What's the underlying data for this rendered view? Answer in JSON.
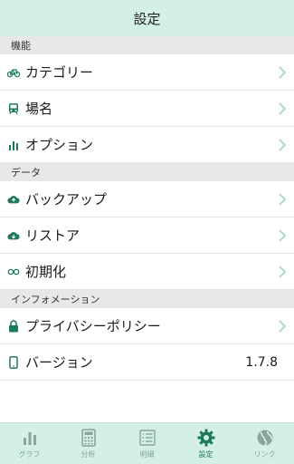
{
  "header": {
    "title": "設定"
  },
  "sections": {
    "function": "機能",
    "data": "データ",
    "info": "インフォメーション"
  },
  "rows": {
    "category": "カテゴリー",
    "place": "場名",
    "option": "オプション",
    "backup": "バックアップ",
    "restore": "リストア",
    "initialize": "初期化",
    "privacy": "プライバシーポリシー",
    "version": "バージョン",
    "version_value": "1.7.8"
  },
  "tabs": [
    {
      "label": "グラフ",
      "icon": "chart-bar-icon"
    },
    {
      "label": "分析",
      "icon": "calculator-icon"
    },
    {
      "label": "明細",
      "icon": "list-icon"
    },
    {
      "label": "設定",
      "icon": "gear-icon"
    },
    {
      "label": "リンク",
      "icon": "globe-icon"
    }
  ],
  "colors": {
    "accent": "#1d7a5f",
    "header_bg": "#d3efe6",
    "section_bg": "#e8e8e8",
    "chevron": "#a9ddca",
    "tab_inactive": "#8aa69c"
  }
}
